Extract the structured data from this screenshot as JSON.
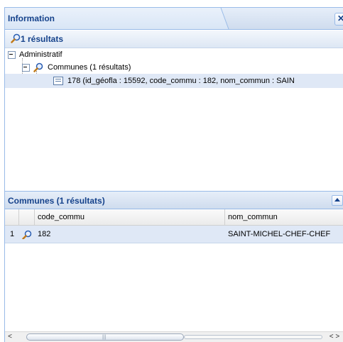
{
  "window": {
    "title": "Information",
    "close_label": "✕"
  },
  "results_bar": {
    "label": "1 résultats"
  },
  "tree": {
    "root": {
      "label": "Administratif"
    },
    "layer": {
      "label": "Communes (1 résultats)"
    },
    "record": {
      "label": "178 (id_géofla : 15592, code_commu : 182, nom_commun : SAIN"
    }
  },
  "grid": {
    "title": "Communes (1 résultats)",
    "columns": [
      "code_commu",
      "nom_commun"
    ],
    "rows": [
      {
        "index": "1",
        "code_commu": "182",
        "nom_commun": "SAINT-MICHEL-CHEF-CHEF"
      }
    ]
  },
  "scrollbar": {
    "left_arrow": "<",
    "right_arrows": "< >",
    "grip": "|||"
  },
  "icons": {
    "magnifier": "magnifier-icon",
    "collapse_toggle": "minus-box-icon",
    "record": "record-icon",
    "close": "close-icon",
    "collapse_panel": "collapse-up-icon"
  }
}
